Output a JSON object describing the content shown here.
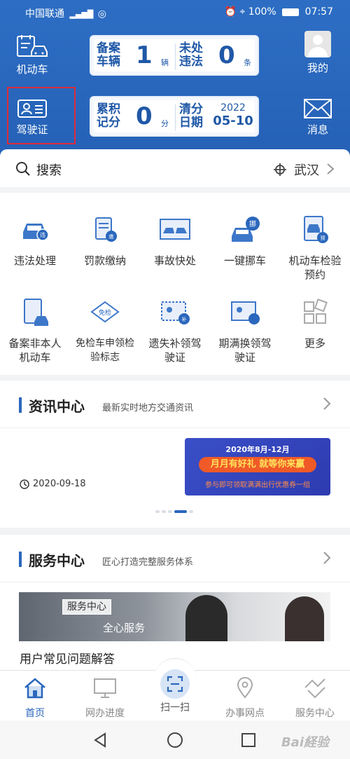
{
  "status_bar": {
    "carrier": "中国联通",
    "battery": "100%",
    "time": "07:57"
  },
  "header": {
    "left_top_label": "机动车",
    "left_bottom_label": "驾驶证",
    "right_top_label": "我的",
    "right_bottom_label": "消息",
    "vehicle_card": {
      "label_a": "备案\n车辆",
      "count_a": "1",
      "unit_a": "辆",
      "label_b": "未处\n违法",
      "count_b": "0",
      "unit_b": "条"
    },
    "license_card": {
      "label_a": "累积\n记分",
      "count_a": "0",
      "unit_a": "分",
      "label_b": "清分\n日期",
      "year": "2022",
      "date": "05-10"
    }
  },
  "search": {
    "placeholder": "搜索",
    "city": "武汉"
  },
  "grid": [
    {
      "icon": "violation-car-icon",
      "label": "违法处理"
    },
    {
      "icon": "fine-payment-icon",
      "label": "罚款缴纳"
    },
    {
      "icon": "accident-icon",
      "label": "事故快处"
    },
    {
      "icon": "move-car-icon",
      "label": "一键挪车"
    },
    {
      "icon": "inspection-booking-icon",
      "label": "机动车检验预约"
    },
    {
      "icon": "register-vehicle-icon",
      "label": "备案非本人机动车"
    },
    {
      "icon": "exempt-inspection-icon",
      "label": "免检车申领检验标志"
    },
    {
      "icon": "reissue-license-icon",
      "label": "遗失补领驾驶证"
    },
    {
      "icon": "renew-license-icon",
      "label": "期满换领驾驶证"
    },
    {
      "icon": "more-icon",
      "label": "更多"
    }
  ],
  "news": {
    "title": "资讯中心",
    "subtitle": "最新实时地方交通资讯",
    "date": "2020-09-18",
    "banner_line1": "2020年8月-12月",
    "banner_line2": "月月有好礼 就等你来赢",
    "banner_line3": "参与即可领取满满出行优惠券一组"
  },
  "service": {
    "title": "服务中心",
    "subtitle": "匠心打造完整服务体系",
    "tag": "服务中心",
    "slogan": "全心服务",
    "faq": "用户常见问题解答"
  },
  "tabs": [
    {
      "label": "首页",
      "icon": "home-icon",
      "active": true
    },
    {
      "label": "网办进度",
      "icon": "monitor-icon",
      "active": false
    },
    {
      "label": "扫一扫",
      "icon": "scan-icon",
      "active": false
    },
    {
      "label": "办事网点",
      "icon": "location-icon",
      "active": false
    },
    {
      "label": "服务中心",
      "icon": "handshake-icon",
      "active": false
    }
  ],
  "colors": {
    "header_blue": "#2a67bd",
    "highlight_red": "#e02b3a",
    "banner_orange": "#f05a28"
  }
}
